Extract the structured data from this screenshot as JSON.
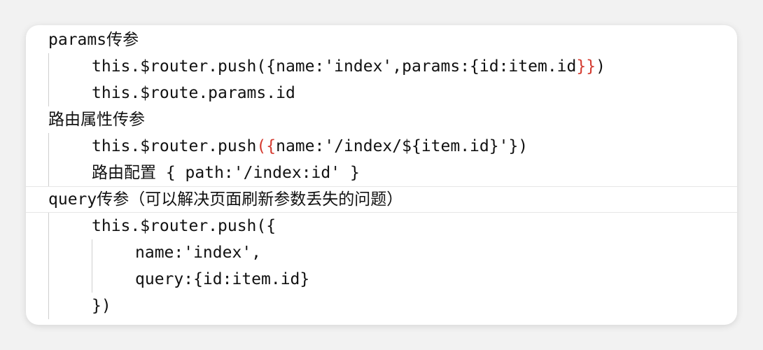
{
  "lines": [
    {
      "head": "params",
      "cjk": "传参"
    },
    {
      "code_a": "this.$router.push({name:'index',params:{id:item.id",
      "red": "}}",
      "code_b": ")"
    },
    {
      "code": "this.$route.params.id"
    },
    {
      "cjk": "路由属性传参"
    },
    {
      "code_a": "this.$router.push",
      "red": "({",
      "code_b": "name:'/index/${item.id}'})"
    },
    {
      "cjk": "路由配置",
      "code": " { path:'/index:id' }"
    },
    {
      "head": "query",
      "cjk": "传参（可以解决页面刷新参数丢失的问题）"
    },
    {
      "code": "this.$router.push({"
    },
    {
      "code": "name:'index',"
    },
    {
      "code": "query:{id:item.id}"
    },
    {
      "code": "})"
    }
  ],
  "colors": {
    "text": "#111111",
    "bracket_highlight": "#d43a2f",
    "guide": "#cfcfcf"
  }
}
